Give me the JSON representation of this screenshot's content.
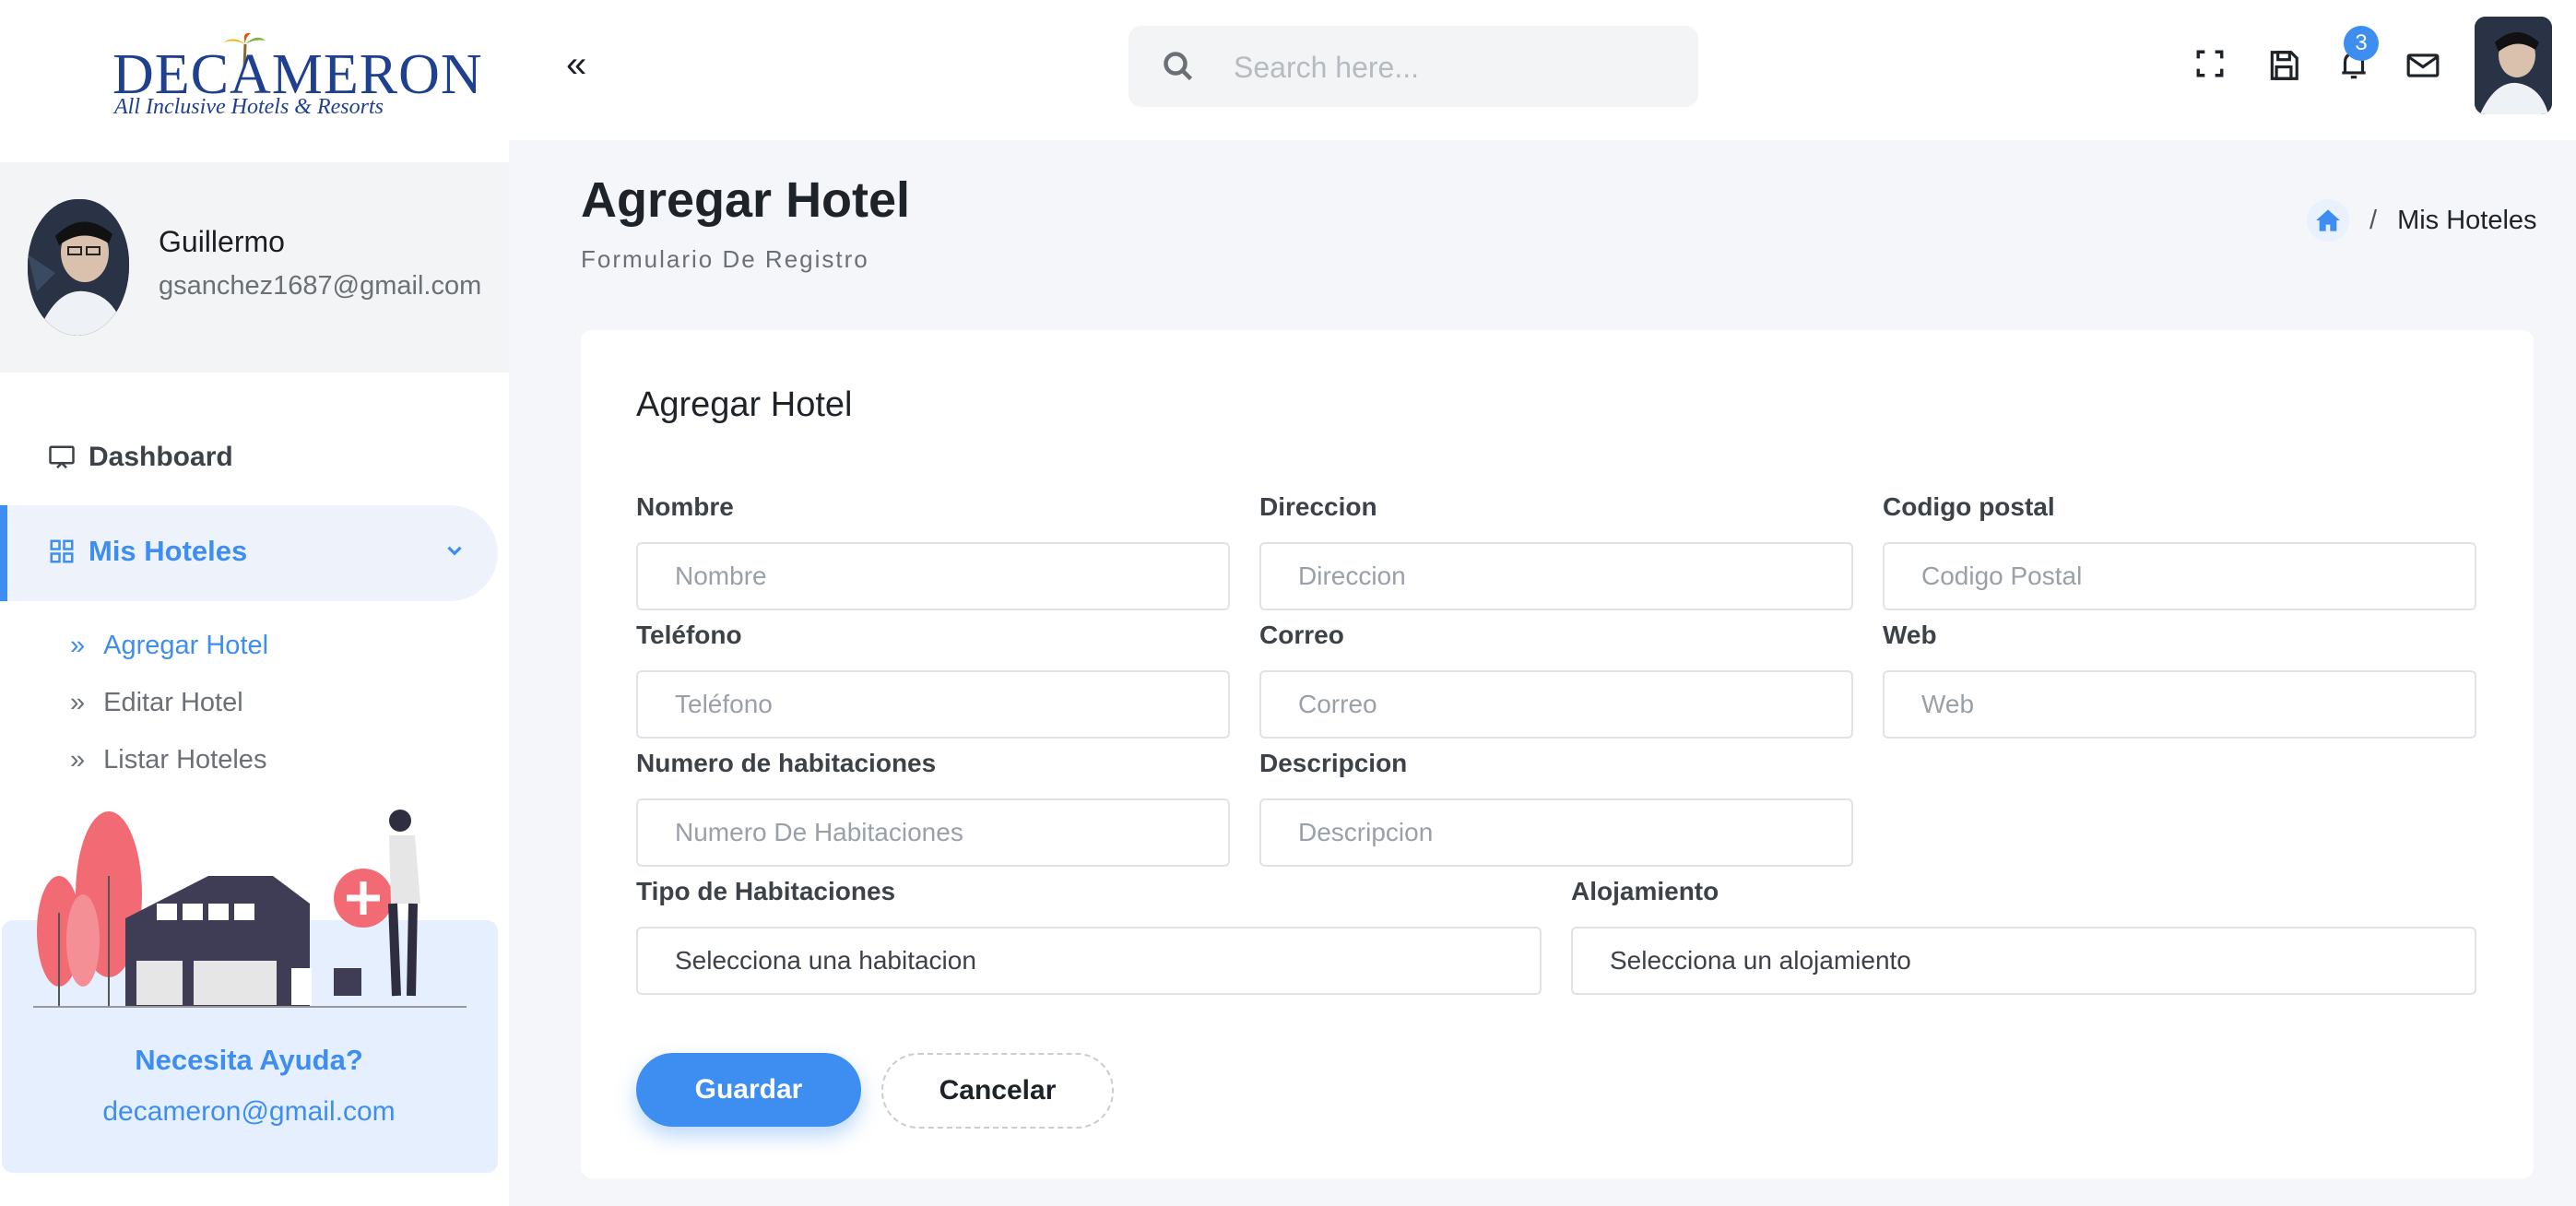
{
  "brand": {
    "name": "DECAMERON",
    "tagline": "All Inclusive Hotels & Resorts"
  },
  "user": {
    "name": "Guillermo",
    "email": "gsanchez1687@gmail.com"
  },
  "nav": {
    "dashboard": "Dashboard",
    "hotels": "Mis Hoteles",
    "sub": [
      "Agregar Hotel",
      "Editar Hotel",
      "Listar Hoteles"
    ]
  },
  "help": {
    "title": "Necesita Ayuda?",
    "email": "decameron@gmail.com"
  },
  "header": {
    "search_placeholder": "Search here...",
    "notification_count": "3"
  },
  "page": {
    "title": "Agregar Hotel",
    "subtitle": "Formulario De Registro"
  },
  "breadcrumb": {
    "current": "Mis Hoteles",
    "separator": "/"
  },
  "form": {
    "title": "Agregar Hotel",
    "fields": {
      "nombre": {
        "label": "Nombre",
        "placeholder": "Nombre"
      },
      "direccion": {
        "label": "Direccion",
        "placeholder": "Direccion"
      },
      "codigo": {
        "label": "Codigo postal",
        "placeholder": "Codigo Postal"
      },
      "telefono": {
        "label": "Teléfono",
        "placeholder": "Teléfono"
      },
      "correo": {
        "label": "Correo",
        "placeholder": "Correo"
      },
      "web": {
        "label": "Web",
        "placeholder": "Web"
      },
      "habitaciones": {
        "label": "Numero de habitaciones",
        "placeholder": "Numero De Habitaciones"
      },
      "descripcion": {
        "label": "Descripcion",
        "placeholder": "Descripcion"
      },
      "tipo": {
        "label": "Tipo de Habitaciones",
        "value": "Selecciona una habitacion"
      },
      "alojamiento": {
        "label": "Alojamiento",
        "value": "Selecciona un alojamiento"
      }
    },
    "save": "Guardar",
    "cancel": "Cancelar"
  },
  "colors": {
    "accent": "#3d8ef0",
    "brand": "#1f3f8f",
    "help_bg": "#e6effd"
  }
}
